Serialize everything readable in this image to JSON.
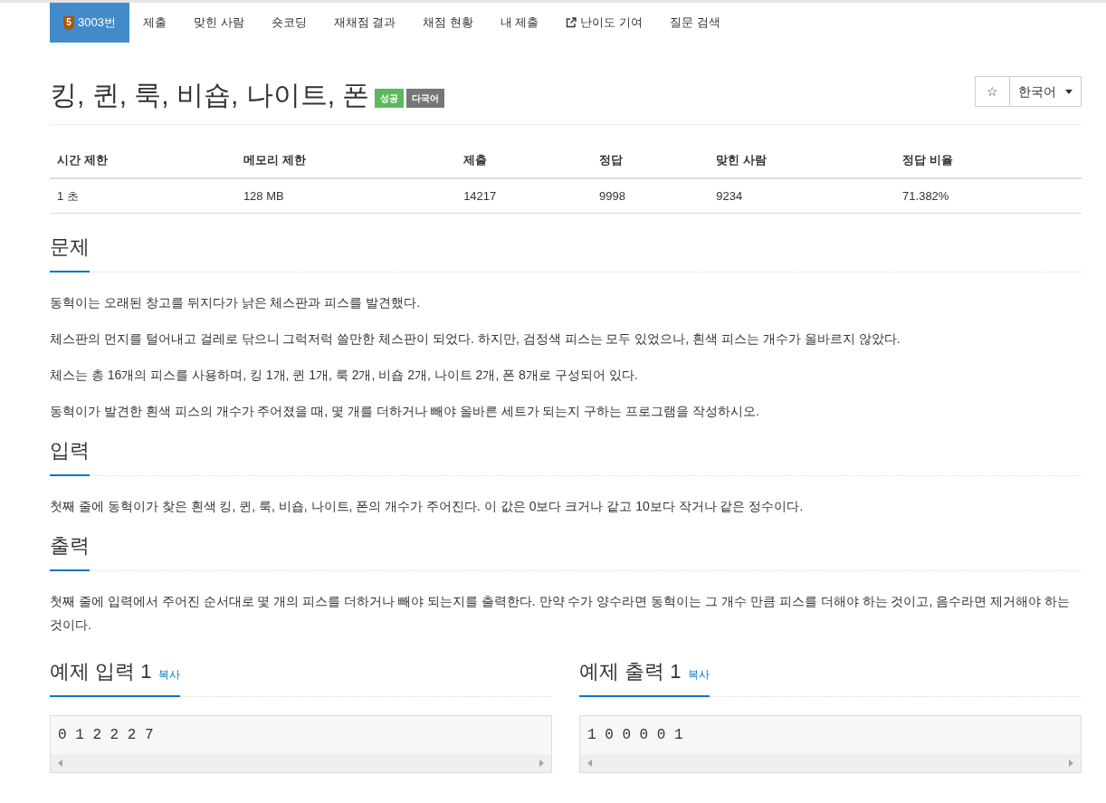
{
  "nav": {
    "tabs": [
      {
        "label": "3003번",
        "selected": true,
        "tier_badge": "5",
        "external": false
      },
      {
        "label": "제출",
        "selected": false,
        "external": false
      },
      {
        "label": "맞힌 사람",
        "selected": false,
        "external": false
      },
      {
        "label": "숏코딩",
        "selected": false,
        "external": false
      },
      {
        "label": "재채점 결과",
        "selected": false,
        "external": false
      },
      {
        "label": "채점 현황",
        "selected": false,
        "external": false
      },
      {
        "label": "내 제출",
        "selected": false,
        "external": false
      },
      {
        "label": "난이도 기여",
        "selected": false,
        "external": true
      },
      {
        "label": "질문 검색",
        "selected": false,
        "external": false
      }
    ]
  },
  "problem": {
    "title": "킹, 퀸, 룩, 비숍, 나이트, 폰",
    "labels": [
      {
        "text": "성공",
        "color": "#5cb85c"
      },
      {
        "text": "다국어",
        "color": "#777777"
      }
    ],
    "favorite_star": "☆",
    "language": "한국어"
  },
  "limits_table": {
    "columns": [
      "시간 제한",
      "메모리 제한",
      "제출",
      "정답",
      "맞힌 사람",
      "정답 비율"
    ],
    "rows": [
      [
        "1 초",
        "128 MB",
        "14217",
        "9998",
        "9234",
        "71.382%"
      ]
    ]
  },
  "sections": [
    {
      "heading": "문제",
      "paragraphs": [
        "동혁이는 오래된 창고를 뒤지다가 낡은 체스판과 피스를 발견했다.",
        "체스판의 먼지를 털어내고 걸레로 닦으니 그럭저럭 쓸만한 체스판이 되었다. 하지만, 검정색 피스는 모두 있었으나, 흰색 피스는 개수가 올바르지 않았다.",
        "체스는 총 16개의 피스를 사용하며, 킹 1개, 퀸 1개, 룩 2개, 비숍 2개, 나이트 2개, 폰 8개로 구성되어 있다.",
        "동혁이가 발견한 흰색 피스의 개수가 주어졌을 때, 몇 개를 더하거나 빼야 올바른 세트가 되는지 구하는 프로그램을 작성하시오."
      ]
    },
    {
      "heading": "입력",
      "paragraphs": [
        "첫째 줄에 동혁이가 찾은 흰색 킹, 퀸, 룩, 비숍, 나이트, 폰의 개수가 주어진다. 이 값은 0보다 크거나 같고 10보다 작거나 같은 정수이다."
      ]
    },
    {
      "heading": "출력",
      "paragraphs": [
        "첫째 줄에 입력에서 주어진 순서대로 몇 개의 피스를 더하거나 빼야 되는지를 출력한다. 만약 수가 양수라면 동혁이는 그 개수 만큼 피스를 더해야 하는 것이고, 음수라면 제거해야 하는 것이다."
      ]
    }
  ],
  "samples": [
    {
      "heading": "예제 입력 1",
      "copy": "복사",
      "content": "0 1 2 2 2 7"
    },
    {
      "heading": "예제 출력 1",
      "copy": "복사",
      "content": "1 0 0 0 0 1"
    }
  ]
}
